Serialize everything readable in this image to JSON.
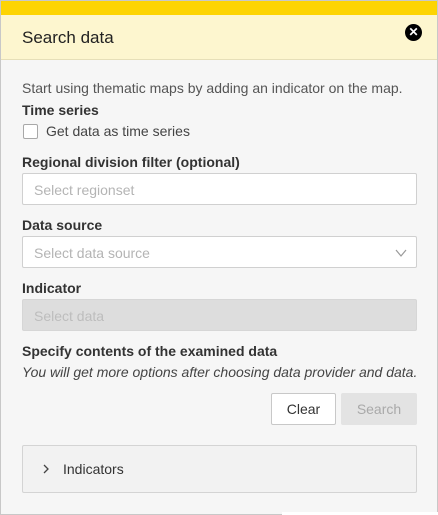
{
  "header": {
    "title": "Search data",
    "close_icon": "close-icon"
  },
  "intro_text": "Start using thematic maps by adding an indicator on the map.",
  "time_series": {
    "label": "Time series",
    "checkbox_label": "Get data as time series",
    "checked": false
  },
  "regional_filter": {
    "label": "Regional division filter (optional)",
    "placeholder": "Select regionset"
  },
  "data_source": {
    "label": "Data source",
    "placeholder": "Select data source",
    "icon": "chevron-down-icon"
  },
  "indicator": {
    "label": "Indicator",
    "placeholder": "Select data"
  },
  "specify": {
    "label": "Specify contents of the examined data",
    "note": "You will get more options after choosing data provider and data."
  },
  "buttons": {
    "clear": "Clear",
    "search": "Search"
  },
  "accordion": {
    "label": "Indicators",
    "icon": "chevron-right-icon"
  },
  "colors": {
    "accent": "#fdd403",
    "header_bg": "#fdf6cf",
    "panel_bg": "#f6f6f6"
  }
}
